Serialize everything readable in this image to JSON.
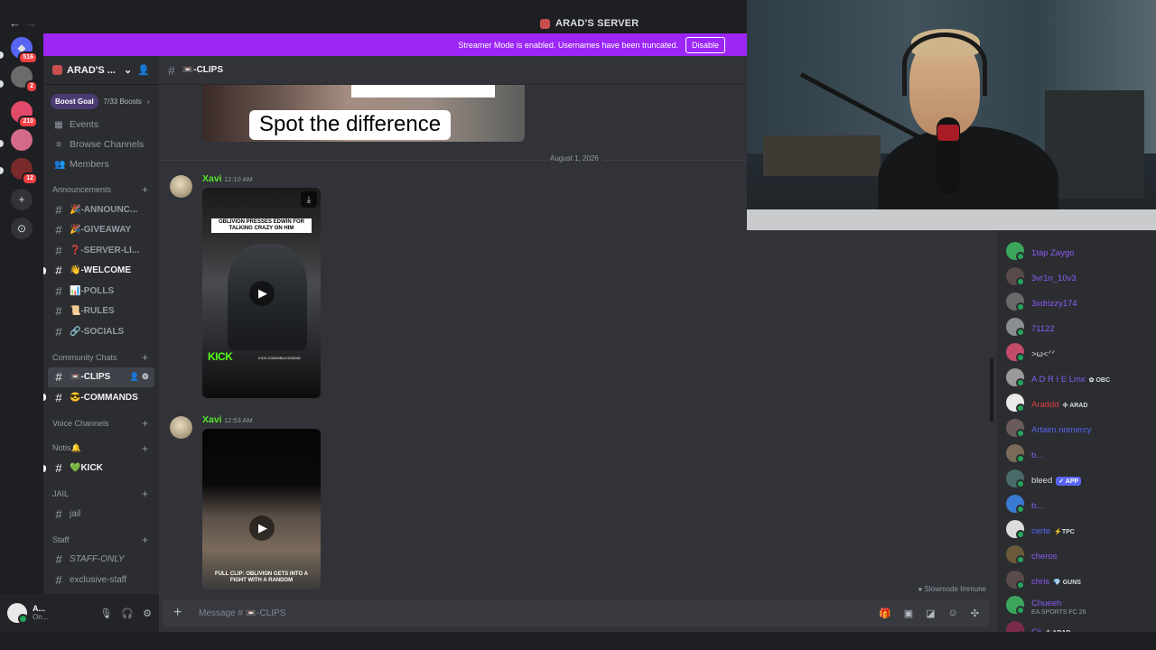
{
  "window": {
    "title": "ARAD'S SERVER"
  },
  "guilds": [
    {
      "name": "discord-home-icon",
      "badge": "516",
      "color": "#5865f2",
      "glyph": "◆"
    },
    {
      "name": "guild-2",
      "badge": "2",
      "color": "#6b6b6b",
      "glyph": ""
    },
    {
      "name": "guild-3",
      "badge": "210",
      "color": "#e14a6a",
      "glyph": ""
    },
    {
      "name": "guild-4",
      "badge": "",
      "color": "#d46a8a",
      "glyph": ""
    },
    {
      "name": "guild-5",
      "badge": "12",
      "color": "#7a2a2a",
      "glyph": ""
    }
  ],
  "banner": {
    "text": "Streamer Mode is enabled. Usernames have been truncated.",
    "button": "Disable"
  },
  "sidebar": {
    "server_name": "ARAD'S ...",
    "boost_pill": "Boost Goal",
    "boost_count": "7/33 Boosts",
    "links": [
      {
        "label": "Events",
        "icon": "calendar-icon"
      },
      {
        "label": "Browse Channels",
        "icon": "browse-icon"
      },
      {
        "label": "Members",
        "icon": "members-icon"
      }
    ],
    "categories": {
      "announcements": "Announcements",
      "community": "Community Chats",
      "voice": "Voice Channels",
      "notis": "Notis🔔",
      "jail": "JAIL",
      "staff": "Staff"
    },
    "announcement_channels": [
      {
        "label": "🎉-ANNOUNC...",
        "unread": false
      },
      {
        "label": "🎉-GIVEAWAY",
        "unread": false
      },
      {
        "label": "❓-SERVER-LI...",
        "unread": false
      },
      {
        "label": "👋-WELCOME",
        "unread": true
      },
      {
        "label": "📊-POLLS",
        "unread": false
      },
      {
        "label": "📜-RULES",
        "unread": false
      },
      {
        "label": "🔗-SOCIALS",
        "unread": false
      }
    ],
    "community_channels": [
      {
        "label": "📼-CLIPS",
        "active": true
      },
      {
        "label": "😎-COMMANDS",
        "unread": true
      }
    ],
    "notis_channels": [
      {
        "label": "💚KICK",
        "unread": true
      }
    ],
    "jail_channels": [
      {
        "label": "jail"
      }
    ],
    "staff_channels": [
      {
        "label": "STAFF-ONLY"
      },
      {
        "label": "exclusive-staff"
      }
    ]
  },
  "user_panel": {
    "name": "A...",
    "status": "On..."
  },
  "channel": {
    "name": "📼-CLIPS",
    "prev_caption": "Spot the difference",
    "date_divider": "August 1, 2026",
    "messages": [
      {
        "author": "Xavi",
        "time": "12:10 AM",
        "video_title": "OBLIVION PRESSES EDWIN FOR TALKING CRAZY ON HIM",
        "watermark": "KICK",
        "url": "KICK.COM/OBLIVIONOW"
      },
      {
        "author": "Xavi",
        "time": "12:53 AM",
        "video_title": "FULL CLIP: OBLIVION GETS INTO A FIGHT WITH A RANDOM"
      }
    ],
    "slowmode": "Slowmode Immune",
    "composer_placeholder": "Message # 📼-CLIPS"
  },
  "members": [
    {
      "name": "1tap Zaygo",
      "color": "#8a5cf5",
      "avatar": "#3ba55c",
      "tag": "",
      "sub": ""
    },
    {
      "name": "3vr1n_10v3",
      "color": "#8a5cf5",
      "avatar": "#5a4a4a",
      "tag": "",
      "sub": ""
    },
    {
      "name": "3xdrizzy174",
      "color": "#8a5cf5",
      "avatar": "#6a6a6a",
      "tag": "",
      "sub": ""
    },
    {
      "name": "71122",
      "color": "#8a5cf5",
      "avatar": "#8a8d91",
      "tag": "",
      "sub": ""
    },
    {
      "name": ">ω<ᐟᐟ",
      "color": "#dbdee1",
      "avatar": "#c34b6a",
      "tag": "",
      "sub": ""
    },
    {
      "name": "A D R I E Lmx",
      "color": "#8a5cf5",
      "avatar": "#9a9a9a",
      "tag": "✿ OBC",
      "sub": ""
    },
    {
      "name": "Araddd",
      "color": "#e03e3e",
      "avatar": "#e9e9e9",
      "tag": "✣ ARAD",
      "sub": ""
    },
    {
      "name": "Artaim.nomercy",
      "color": "#5865f2",
      "avatar": "#6a5a5a",
      "tag": "",
      "sub": ""
    },
    {
      "name": "b...",
      "color": "#8a5cf5",
      "avatar": "#7a6a5a",
      "tag": "",
      "sub": ""
    },
    {
      "name": "bleed",
      "color": "#dbdee1",
      "avatar": "#4a6a6a",
      "tag": "✓ APP",
      "sub": ""
    },
    {
      "name": "b...",
      "color": "#8a5cf5",
      "avatar": "#3a7ad0",
      "tag": "",
      "sub": ""
    },
    {
      "name": "certe",
      "color": "#5865f2",
      "avatar": "#dcdcdc",
      "tag": "⚡TPC",
      "sub": ""
    },
    {
      "name": "cheros",
      "color": "#8a5cf5",
      "avatar": "#6a5a3a",
      "tag": "",
      "sub": ""
    },
    {
      "name": "chris",
      "color": "#8a5cf5",
      "avatar": "#5a4a4a",
      "tag": "💎 GUNS",
      "sub": ""
    },
    {
      "name": "Chueeh",
      "color": "#8a5cf5",
      "avatar": "#3ba55c",
      "tag": "",
      "sub": "EA SPORTS FC 26"
    },
    {
      "name": "Ck",
      "color": "#8a5cf5",
      "avatar": "#7a2a4a",
      "tag": "✣ ARAD",
      "sub": ""
    }
  ],
  "colors": {
    "accent": "#5865f2",
    "streamer_banner": "#9b26f5",
    "online": "#23a55a",
    "author_green": "#57e32c"
  }
}
